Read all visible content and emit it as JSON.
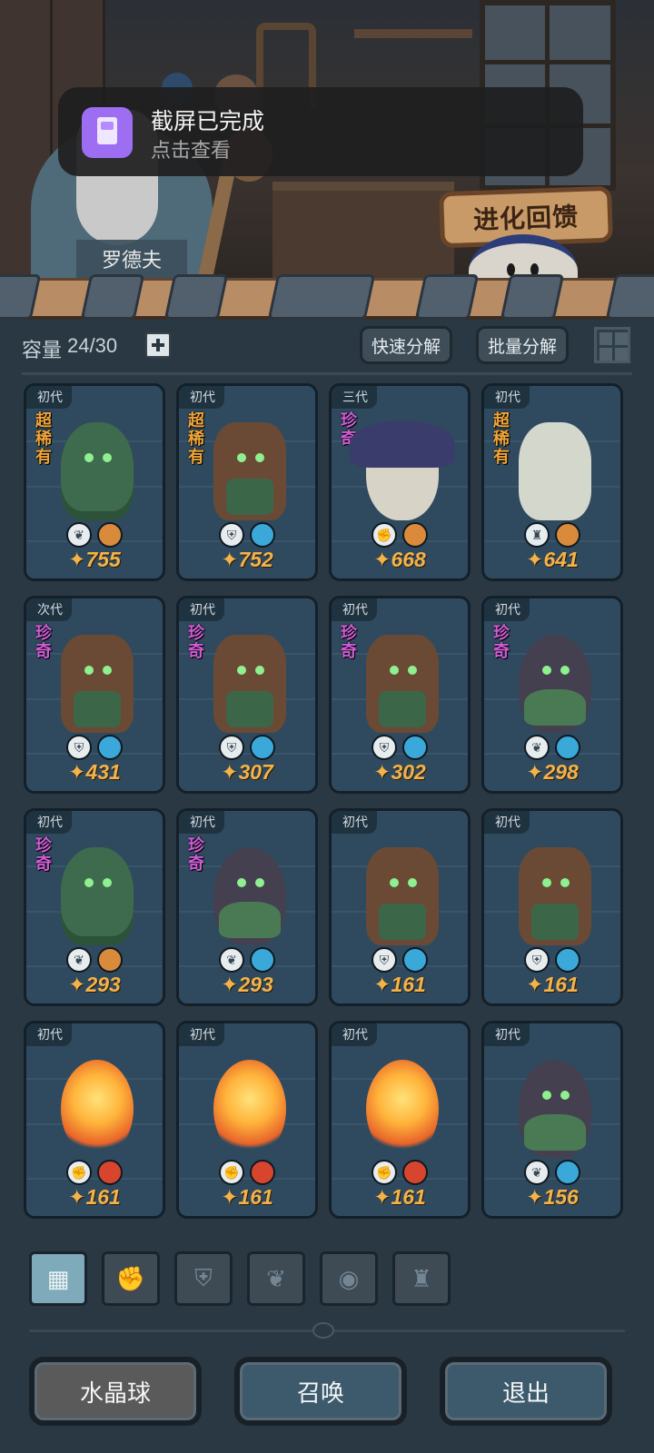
{
  "notification": {
    "title": "截屏已完成",
    "subtitle": "点击查看",
    "icon": "screenshot-icon"
  },
  "scene": {
    "npc_name": "罗德夫",
    "evolve_button": "进化回馈"
  },
  "toolbar": {
    "capacity_label": "容量",
    "capacity_value": "24/30",
    "add_icon": "plus-icon",
    "quick_decompose": "快速分解",
    "batch_decompose": "批量分解",
    "view_toggle_icon": "grid-view-icon"
  },
  "cards": [
    {
      "gen": "初代",
      "rarity": "超稀有",
      "rarity_class": "super",
      "creature": "bush",
      "type_icon": "sprout-icon",
      "type_glyph": "❦",
      "element": "earth",
      "element_color": "#d98a3a",
      "power": "755"
    },
    {
      "gen": "初代",
      "rarity": "超稀有",
      "rarity_class": "super",
      "creature": "tree",
      "type_icon": "shield-icon",
      "type_glyph": "⛨",
      "element": "water",
      "element_color": "#3aa8d8",
      "power": "752"
    },
    {
      "gen": "三代",
      "rarity": "珍奇",
      "rarity_class": "rare",
      "creature": "mush",
      "type_icon": "fist-icon",
      "type_glyph": "✊",
      "element": "earth",
      "element_color": "#d98a3a",
      "power": "668"
    },
    {
      "gen": "初代",
      "rarity": "超稀有",
      "rarity_class": "super",
      "creature": "dragon",
      "type_icon": "tower-icon",
      "type_glyph": "♜",
      "element": "earth",
      "element_color": "#d98a3a",
      "power": "641"
    },
    {
      "gen": "次代",
      "rarity": "珍奇",
      "rarity_class": "rare",
      "creature": "tree",
      "type_icon": "shield-icon",
      "type_glyph": "⛨",
      "element": "water",
      "element_color": "#3aa8d8",
      "power": "431"
    },
    {
      "gen": "初代",
      "rarity": "珍奇",
      "rarity_class": "rare",
      "creature": "tree",
      "type_icon": "shield-icon",
      "type_glyph": "⛨",
      "element": "water",
      "element_color": "#3aa8d8",
      "power": "307"
    },
    {
      "gen": "初代",
      "rarity": "珍奇",
      "rarity_class": "rare",
      "creature": "tree",
      "type_icon": "shield-icon",
      "type_glyph": "⛨",
      "element": "water",
      "element_color": "#3aa8d8",
      "power": "302"
    },
    {
      "gen": "初代",
      "rarity": "珍奇",
      "rarity_class": "rare",
      "creature": "wisp",
      "type_icon": "sprout-icon",
      "type_glyph": "❦",
      "element": "water",
      "element_color": "#3aa8d8",
      "power": "298"
    },
    {
      "gen": "初代",
      "rarity": "珍奇",
      "rarity_class": "rare",
      "creature": "bush",
      "type_icon": "sprout-icon",
      "type_glyph": "❦",
      "element": "earth",
      "element_color": "#d98a3a",
      "power": "293"
    },
    {
      "gen": "初代",
      "rarity": "珍奇",
      "rarity_class": "rare",
      "creature": "wisp",
      "type_icon": "sprout-icon",
      "type_glyph": "❦",
      "element": "water",
      "element_color": "#3aa8d8",
      "power": "293"
    },
    {
      "gen": "初代",
      "rarity": "",
      "rarity_class": "",
      "creature": "tree",
      "type_icon": "shield-icon",
      "type_glyph": "⛨",
      "element": "water",
      "element_color": "#3aa8d8",
      "power": "161"
    },
    {
      "gen": "初代",
      "rarity": "",
      "rarity_class": "",
      "creature": "tree",
      "type_icon": "shield-icon",
      "type_glyph": "⛨",
      "element": "water",
      "element_color": "#3aa8d8",
      "power": "161"
    },
    {
      "gen": "初代",
      "rarity": "",
      "rarity_class": "",
      "creature": "fire",
      "type_icon": "fist-icon",
      "type_glyph": "✊",
      "element": "fire",
      "element_color": "#d8452f",
      "power": "161"
    },
    {
      "gen": "初代",
      "rarity": "",
      "rarity_class": "",
      "creature": "fire",
      "type_icon": "fist-icon",
      "type_glyph": "✊",
      "element": "fire",
      "element_color": "#d8452f",
      "power": "161"
    },
    {
      "gen": "初代",
      "rarity": "",
      "rarity_class": "",
      "creature": "fire",
      "type_icon": "fist-icon",
      "type_glyph": "✊",
      "element": "fire",
      "element_color": "#d8452f",
      "power": "161"
    },
    {
      "gen": "初代",
      "rarity": "",
      "rarity_class": "",
      "creature": "wisp",
      "type_icon": "sprout-icon",
      "type_glyph": "❦",
      "element": "water",
      "element_color": "#3aa8d8",
      "power": "156"
    }
  ],
  "power_icon": "power-glyph-icon",
  "power_glyph": "✦",
  "category_tabs": [
    {
      "icon": "all-blocks-icon",
      "glyph": "▦",
      "active": true
    },
    {
      "icon": "fist-icon",
      "glyph": "✊",
      "active": false
    },
    {
      "icon": "shield-icon",
      "glyph": "⛨",
      "active": false
    },
    {
      "icon": "sprout-icon",
      "glyph": "❦",
      "active": false
    },
    {
      "icon": "alien-head-icon",
      "glyph": "◉",
      "active": false
    },
    {
      "icon": "tower-icon",
      "glyph": "♜",
      "active": false
    }
  ],
  "buttons": {
    "crystal_ball": "水晶球",
    "summon": "召唤",
    "exit": "退出"
  }
}
